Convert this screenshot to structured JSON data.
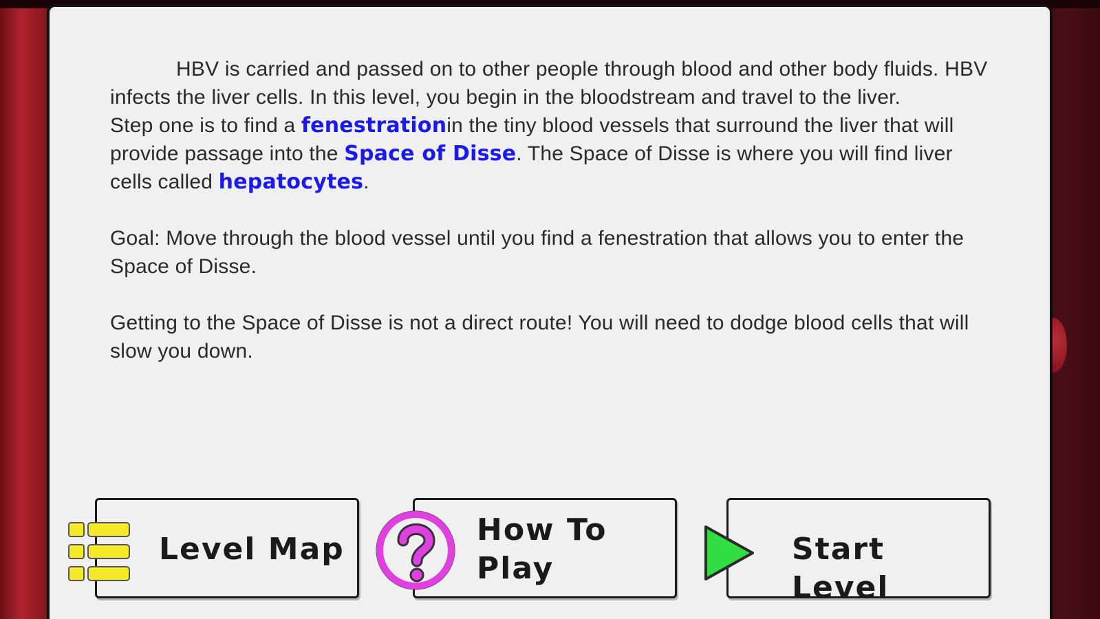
{
  "intro": {
    "p1": "HBV is carried and passed on to other people through blood and other body fluids. HBV infects the liver cells. In this level, you begin in the bloodstream and travel to the liver.",
    "p2": {
      "t1": "Step one is to find a ",
      "k1": "fenestration",
      "t2": "in the tiny blood vessels that surround the liver that will provide passage into the ",
      "k2": "Space of Disse",
      "t3": ". The Space of Disse is where you will find liver cells called ",
      "k3": "hepatocytes",
      "t4": "."
    },
    "p3": "Goal: Move through the blood vessel until you find a fenestration that allows you to enter the Space of Disse.",
    "p4": "Getting to the Space of Disse is not a direct route! You will need to dodge blood cells that will slow you down."
  },
  "buttons": {
    "level_map": {
      "label": "Level Map",
      "icon": "list-icon"
    },
    "how_to_play": {
      "label_line1": "How To",
      "label_line2": "Play",
      "icon": "question-icon"
    },
    "start_level": {
      "label": "Start Level",
      "icon": "play-icon"
    }
  },
  "colors": {
    "keyword": "#1a1aee",
    "panel": "#f0f0f0",
    "list_icon": "#f5ea2a",
    "question_icon": "#e040e0",
    "play_icon": "#33dd44"
  }
}
